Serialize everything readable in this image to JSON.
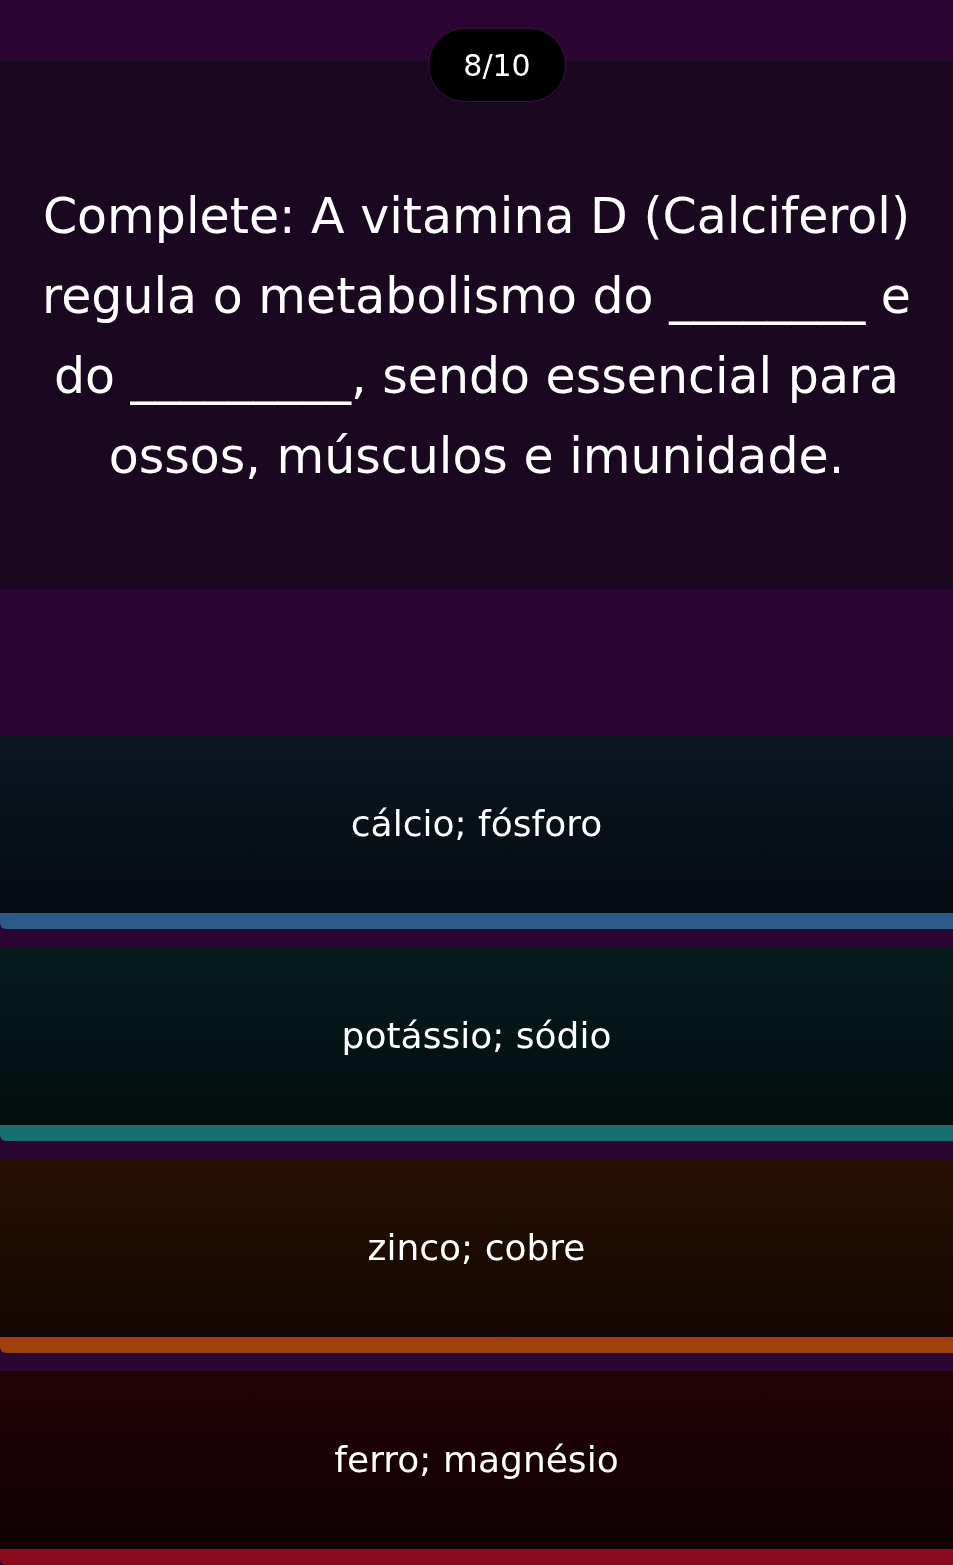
{
  "progress": {
    "counter": "8/10"
  },
  "question": {
    "text": "Complete: A vitamina D (Calciferol) regula o metabolismo do ________ e do _________, sendo essencial para ossos, músculos e imunidade."
  },
  "options": [
    {
      "label": "cálcio; fósforo",
      "color": "#2c5a8a"
    },
    {
      "label": "potássio; sódio",
      "color": "#167070"
    },
    {
      "label": "zinco; cobre",
      "color": "#a0400a"
    },
    {
      "label": "ferro; magnésio",
      "color": "#8a0a1e"
    }
  ]
}
